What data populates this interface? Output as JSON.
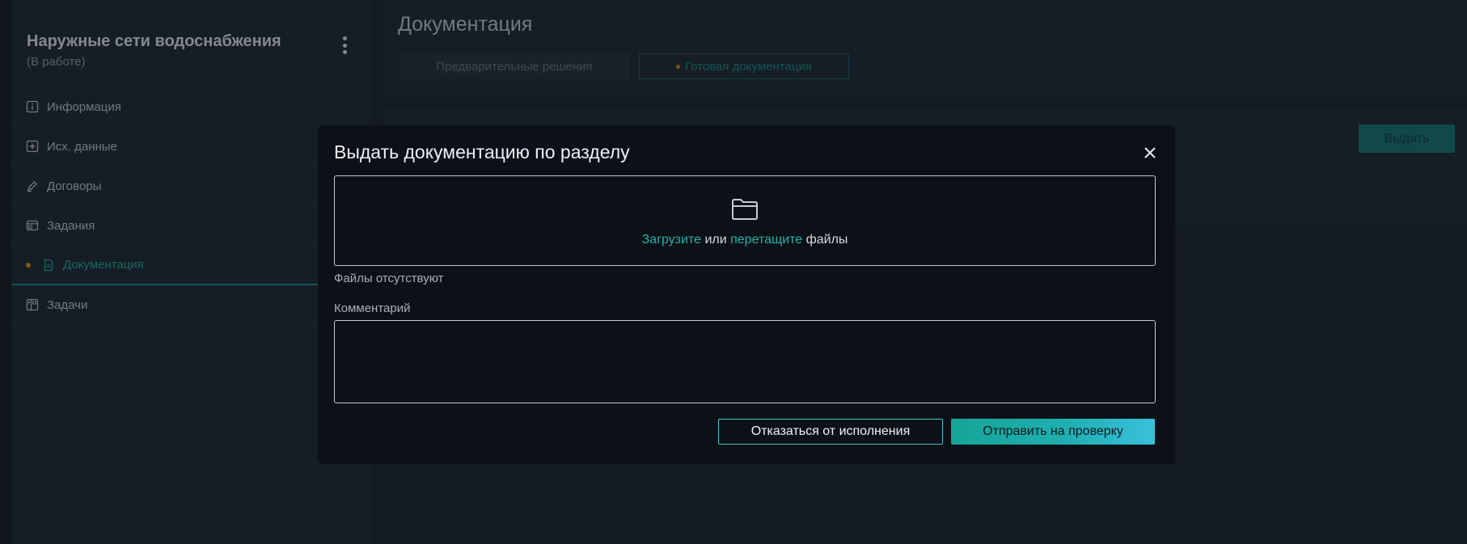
{
  "sidebar": {
    "project_title": "Наружные сети водоснабжения",
    "project_status": "(В работе)",
    "items": [
      {
        "label": "Информация",
        "icon": "info-square-icon"
      },
      {
        "label": "Исх. данные",
        "icon": "plus-square-icon"
      },
      {
        "label": "Договоры",
        "icon": "pen-icon"
      },
      {
        "label": "Задания",
        "icon": "window-icon"
      },
      {
        "label": "Документация",
        "icon": "document-icon",
        "active": true
      },
      {
        "label": "Задачи",
        "icon": "board-icon"
      }
    ]
  },
  "header": {
    "title": "Документация",
    "tabs": [
      {
        "label": "Предварительные решения"
      },
      {
        "label": "Готовая документация",
        "active": true
      }
    ]
  },
  "content": {
    "issue_button": "Выдать"
  },
  "modal": {
    "title": "Выдать документацию по разделу",
    "dropzone": {
      "upload_link": "Загрузите",
      "or": "или",
      "drag_link": "перетащите",
      "files": "файлы"
    },
    "files_empty": "Файлы отсутствуют",
    "comment_label": "Комментарий",
    "comment_value": "",
    "refuse_button": "Отказаться от исполнения",
    "submit_button": "Отправить на проверку"
  },
  "colors": {
    "accent": "#1eaeb0",
    "link": "#23b3a3",
    "active_dot": "#c8881a"
  }
}
